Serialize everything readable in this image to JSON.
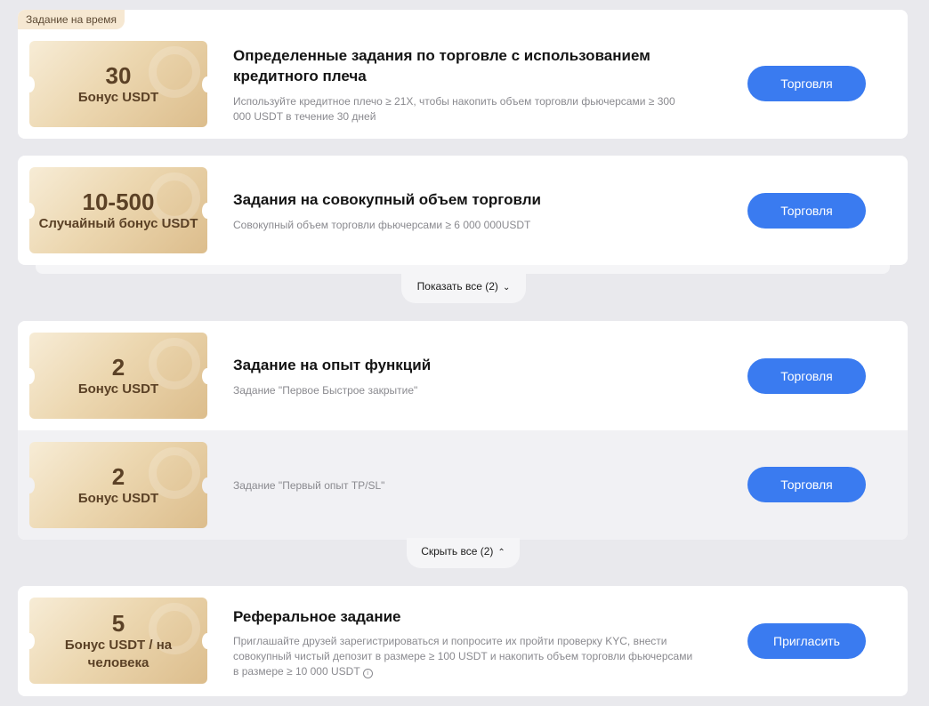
{
  "tasks": [
    {
      "badge": "Задание на время",
      "coupon_amount": "30",
      "coupon_unit": "Бонус USDT",
      "title": "Определенные задания по торговле с использованием кредитного плеча",
      "description": "Используйте кредитное плечо ≥ 21X, чтобы накопить объем торговли фьючерсами ≥ 300 000 USDT в течение 30 дней",
      "button_label": "Торговля"
    },
    {
      "coupon_amount": "10-500",
      "coupon_unit": "Случайный бонус USDT",
      "title": "Задания на совокупный объем торговли",
      "description": "Совокупный объем торговли фьючерсами ≥ 6 000 000USDT",
      "button_label": "Торговля"
    },
    {
      "coupon_amount": "2",
      "coupon_unit": "Бонус USDT",
      "title": "Задание на опыт функций",
      "description": "Задание \"Первое Быстрое закрытие\"",
      "button_label": "Торговля"
    },
    {
      "coupon_amount": "2",
      "coupon_unit": "Бонус USDT",
      "title": "",
      "description": "Задание \"Первый опыт TP/SL\"",
      "button_label": "Торговля"
    },
    {
      "coupon_amount": "5",
      "coupon_unit": "Бонус USDT / на человека",
      "title": "Реферальное задание",
      "description": "Приглашайте друзей зарегистрироваться и попросите их пройти проверку KYC, внести совокупный чистый депозит в размере ≥ 100 USDT и накопить объем торговли фьючерсами в размере ≥ 10 000 USDT",
      "button_label": "Пригласить"
    }
  ],
  "toggles": {
    "show_all": "Показать все (2)",
    "hide_all": "Скрыть все (2)"
  },
  "icons": {
    "coupon_watermark": "coin-logo-icon",
    "show_all_chevron": "chevron-down-icon",
    "hide_all_chevron": "chevron-up-icon",
    "referral_info": "info-icon"
  },
  "colors": {
    "primary_button": "#3a7bf0",
    "coupon_gold": "#ecd7b0",
    "page_background": "#e9e9ed"
  }
}
